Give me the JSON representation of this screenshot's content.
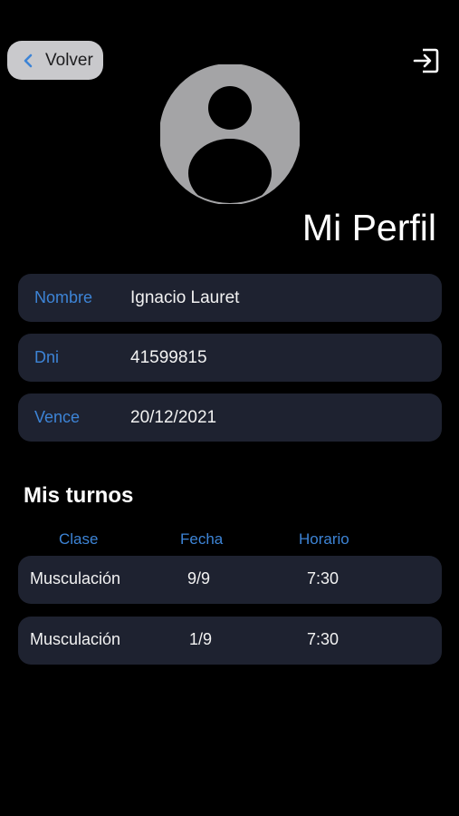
{
  "nav": {
    "back_label": "Volver",
    "back_icon": "chevron-left-icon",
    "logout_icon": "logout-icon"
  },
  "profile": {
    "avatar_icon": "user-avatar-icon",
    "title": "Mi Perfil",
    "fields": [
      {
        "label": "Nombre",
        "value": "Ignacio Lauret"
      },
      {
        "label": "Dni",
        "value": "41599815"
      },
      {
        "label": "Vence",
        "value": "20/12/2021"
      }
    ]
  },
  "turnos": {
    "title": "Mis turnos",
    "headers": {
      "clase": "Clase",
      "fecha": "Fecha",
      "horario": "Horario"
    },
    "rows": [
      {
        "clase": "Musculación",
        "fecha": "9/9",
        "horario": "7:30"
      },
      {
        "clase": "Musculación",
        "fecha": "1/9",
        "horario": "7:30"
      }
    ]
  },
  "colors": {
    "background": "#000000",
    "card": "#1e2230",
    "accent": "#3d84d6",
    "back_button": "#c9c9cc"
  }
}
